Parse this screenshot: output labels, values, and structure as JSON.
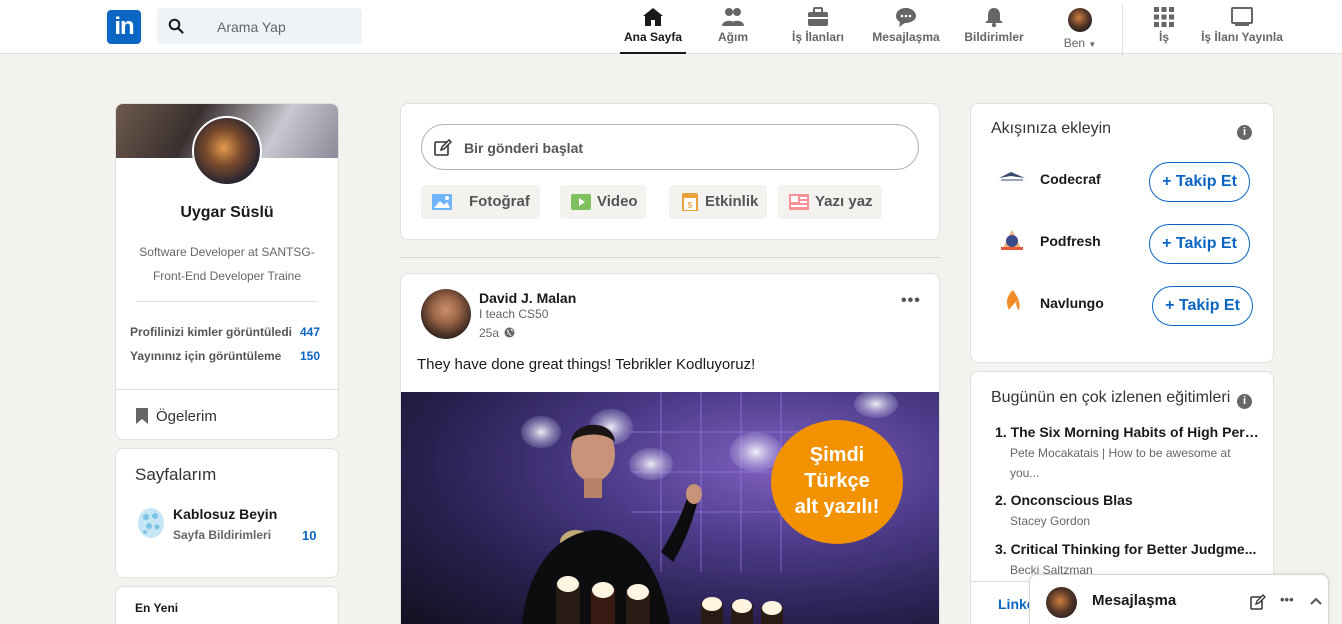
{
  "nav": {
    "logo": "in",
    "search_placeholder": "Arama Yap",
    "items": [
      {
        "label": "Ana Sayfa",
        "icon": "home-icon"
      },
      {
        "label": "Ağım",
        "icon": "network-icon"
      },
      {
        "label": "İş İlanları",
        "icon": "briefcase-icon"
      },
      {
        "label": "Mesajlaşma",
        "icon": "chat-icon"
      },
      {
        "label": "Bildirimler",
        "icon": "bell-icon"
      },
      {
        "label": "Ben",
        "icon": "avatar"
      },
      {
        "label": "İş",
        "icon": "grid-icon"
      },
      {
        "label": "İş İlanı Yayınla",
        "icon": "post-job-icon"
      }
    ]
  },
  "profile": {
    "name": "Uygar Süslü",
    "headline": "Software Developer at SANTSG-Front-End Developer Traine",
    "stats": [
      {
        "label": "Profilinizi kimler görüntüledi",
        "value": "447"
      },
      {
        "label": "Yayınınız için görüntüleme",
        "value": "150"
      }
    ],
    "my_items": "Ögelerim"
  },
  "pages": {
    "title": "Sayfalarım",
    "page_name": "Kablosuz Beyin",
    "page_sub": "Sayfa Bildirimleri",
    "page_count": "10"
  },
  "newest": {
    "label": "En Yeni"
  },
  "share": {
    "start_post": "Bir gönderi başlat",
    "buttons": [
      "Fotoğraf",
      "Video",
      "Etkinlik",
      "Yazı yaz"
    ]
  },
  "post": {
    "author": "David J. Malan",
    "subtitle": "I teach CS50",
    "time": "25a",
    "text": "They have done great things! Tebrikler Kodluyoruz!",
    "image_badge": [
      "Şimdi",
      "Türkçe",
      "alt yazılı!"
    ]
  },
  "feed_add": {
    "title": "Akışınıza ekleyin",
    "follow_label": "+ Takip Et",
    "items": [
      {
        "name": "Codecraf"
      },
      {
        "name": "Podfresh"
      },
      {
        "name": "Navlungo"
      }
    ]
  },
  "courses": {
    "title": "Bugünün en çok izlenen eğitimleri",
    "items": [
      {
        "title": "1. The Six Morning Habits of High Perf...",
        "author": "Pete Mocakatais | How to be awesome at you..."
      },
      {
        "title": "2. Onconscious Blas",
        "author": "Stacey Gordon"
      },
      {
        "title": "3. Critical Thinking for Better Judgme...",
        "author": "Becki Saltzman"
      }
    ]
  },
  "messaging": {
    "title": "Mesajlaşma",
    "peek_link": "Linke"
  },
  "colors": {
    "brand": "#0a66c2",
    "background": "#f3f2ef",
    "badge_orange": "#f39200"
  }
}
